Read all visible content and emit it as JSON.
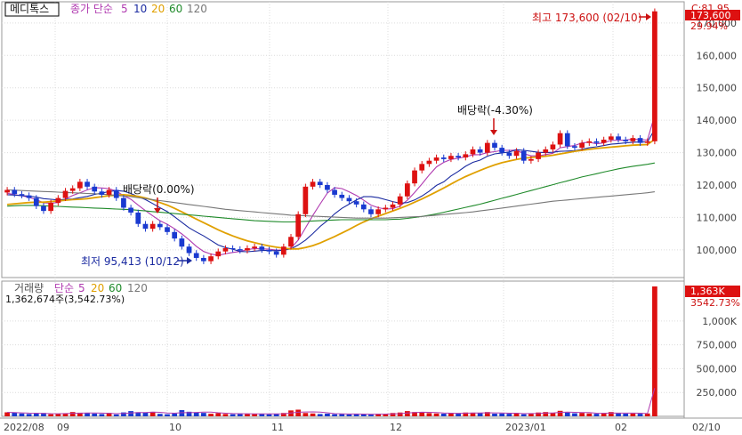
{
  "price_legend": {
    "stock_name": "메디톡스",
    "label": "종가 단순",
    "periods": [
      "5",
      "10",
      "20",
      "60",
      "120"
    ],
    "colors": [
      "#b03ab0",
      "#1a2aa0",
      "#e0a000",
      "#1f8a2a",
      "#777777"
    ]
  },
  "price_right_labels": {
    "top": "C:81.95",
    "current": "173,600",
    "change": "29.94%"
  },
  "volume_legend": {
    "label": "거래량",
    "ma_label": "단순",
    "periods": [
      "5",
      "20",
      "60",
      "120"
    ],
    "colors": [
      "#b03ab0",
      "#e0a000",
      "#1f8a2a",
      "#777777"
    ],
    "value_line": "1,362,674주(3,542.73%)"
  },
  "volume_right_labels": {
    "current": "1,363K",
    "change": "3542.73%"
  },
  "annotations": {
    "high": "최고 173,600 (02/10)",
    "low": "최저 95,413 (10/12)",
    "dividend1": "배당락(0.00%)",
    "dividend2": "배당락(-4.30%)"
  },
  "chart_data": [
    {
      "type": "candlestick",
      "title": "메디톡스",
      "x_labels": [
        "2022/08",
        "09",
        "10",
        "11",
        "12",
        "2023/01",
        "02",
        "02/10"
      ],
      "y_ticks": [
        "100,000",
        "110,000",
        "120,000",
        "130,000",
        "140,000",
        "150,000",
        "160,000",
        "170,000"
      ],
      "ylim": [
        92000,
        176000
      ],
      "series": [
        {
          "name": "종가",
          "values": [
            118500,
            117200,
            116800,
            116000,
            113500,
            112000,
            114500,
            116000,
            118200,
            119000,
            121000,
            119500,
            118000,
            117000,
            118500,
            116000,
            113000,
            111500,
            108000,
            106500,
            108000,
            107000,
            105500,
            103500,
            101000,
            99000,
            97500,
            96500,
            98000,
            99500,
            100500,
            100200,
            99800,
            100500,
            101000,
            100000,
            99500,
            98500,
            101000,
            104000,
            111000,
            119500,
            121000,
            120000,
            118500,
            117000,
            116000,
            115000,
            114000,
            112500,
            111000,
            112500,
            113000,
            114000,
            116500,
            120500,
            124500,
            126500,
            127500,
            128500,
            128000,
            129000,
            128500,
            129500,
            131000,
            130000,
            133000,
            131500,
            130000,
            129000,
            130500,
            127500,
            128000,
            130000,
            131000,
            132500,
            136000,
            132000,
            131500,
            133000,
            133500,
            133000,
            134000,
            135000,
            134000,
            133500,
            134500,
            133000,
            133500,
            173600
          ]
        },
        {
          "name": "5",
          "values": [
            117500,
            117000,
            116700,
            116200,
            115500,
            114500,
            114400,
            114600,
            115700,
            116800,
            117600,
            118500,
            119200,
            119100,
            118900,
            118100,
            116700,
            115600,
            113800,
            112100,
            110500,
            109000,
            107900,
            106500,
            104900,
            103100,
            101100,
            99500,
            98700,
            98300,
            98800,
            99200,
            99500,
            100100,
            100400,
            100300,
            100200,
            99900,
            100000,
            100600,
            103000,
            106800,
            110600,
            114100,
            117500,
            119200,
            118900,
            117900,
            116800,
            115300,
            113800,
            113000,
            112600,
            112700,
            113500,
            115300,
            117700,
            120300,
            123100,
            125600,
            127000,
            127900,
            128300,
            128700,
            129300,
            129400,
            130000,
            130300,
            130700,
            130700,
            130800,
            129700,
            129000,
            129000,
            129400,
            129800,
            131500,
            131900,
            132200,
            133000,
            133200,
            132700,
            133000,
            133800,
            133800,
            133900,
            134200,
            134000,
            133900,
            141600
          ]
        },
        {
          "name": "10",
          "values": [
            117000,
            116900,
            116700,
            116600,
            116300,
            115800,
            115600,
            115400,
            115600,
            115700,
            116100,
            116500,
            117100,
            117500,
            118000,
            118300,
            118100,
            117400,
            116400,
            115500,
            114300,
            113000,
            111800,
            110200,
            108500,
            106800,
            105500,
            104300,
            102900,
            101500,
            100700,
            100200,
            99500,
            99400,
            99600,
            99800,
            99800,
            99700,
            99900,
            100300,
            101500,
            103000,
            105000,
            107200,
            109000,
            111100,
            112800,
            114100,
            115400,
            116400,
            116400,
            116100,
            115500,
            114900,
            114400,
            114600,
            115400,
            116600,
            118100,
            119900,
            121000,
            122800,
            124200,
            125800,
            127000,
            127700,
            128900,
            129600,
            129900,
            130200,
            130900,
            130700,
            130400,
            130100,
            130000,
            130100,
            130400,
            130500,
            130600,
            131000,
            131500,
            131800,
            132200,
            132600,
            132800,
            133000,
            133200,
            133300,
            133300,
            137200
          ]
        },
        {
          "name": "20",
          "values": [
            114000,
            114200,
            114400,
            114600,
            114700,
            114700,
            114900,
            115100,
            115300,
            115500,
            115600,
            115800,
            116100,
            116400,
            116700,
            116900,
            117000,
            116800,
            116500,
            116000,
            115400,
            114600,
            113800,
            112800,
            111700,
            110600,
            109500,
            108400,
            107300,
            106200,
            105200,
            104300,
            103500,
            102800,
            102200,
            101700,
            101200,
            100800,
            100500,
            100300,
            100300,
            100700,
            101300,
            102100,
            103100,
            104100,
            105200,
            106300,
            107500,
            108600,
            109600,
            110400,
            111200,
            112000,
            112800,
            113700,
            114700,
            115700,
            116800,
            117900,
            119100,
            120300,
            121500,
            122600,
            123600,
            124500,
            125400,
            126200,
            126900,
            127400,
            127900,
            128300,
            128500,
            128700,
            128900,
            129200,
            129600,
            130000,
            130400,
            130700,
            131000,
            131300,
            131500,
            131700,
            131900,
            132100,
            132300,
            132400,
            132500,
            134100
          ]
        },
        {
          "name": "60",
          "values": [
            113500,
            113600,
            113700,
            113700,
            113700,
            113600,
            113500,
            113400,
            113300,
            113200,
            113100,
            113000,
            112900,
            112800,
            112700,
            112600,
            112500,
            112400,
            112200,
            112000,
            111800,
            111600,
            111400,
            111200,
            111000,
            110800,
            110600,
            110400,
            110200,
            110000,
            109800,
            109600,
            109400,
            109200,
            109000,
            108900,
            108800,
            108700,
            108600,
            108600,
            108700,
            108800,
            108900,
            109000,
            109100,
            109200,
            109300,
            109300,
            109300,
            109300,
            109300,
            109300,
            109300,
            109400,
            109500,
            109700,
            110000,
            110300,
            110700,
            111100,
            111600,
            112100,
            112600,
            113100,
            113600,
            114100,
            114700,
            115300,
            115900,
            116500,
            117100,
            117700,
            118300,
            118900,
            119500,
            120100,
            120700,
            121300,
            121900,
            122500,
            123000,
            123500,
            124000,
            124500,
            125000,
            125400,
            125800,
            126100,
            126400,
            126800
          ]
        },
        {
          "name": "120",
          "values": [
            118500,
            118400,
            118300,
            118200,
            118100,
            118000,
            117900,
            117800,
            117700,
            117600,
            117500,
            117400,
            117300,
            117200,
            117000,
            116800,
            116600,
            116400,
            116100,
            115800,
            115500,
            115200,
            114900,
            114600,
            114300,
            114000,
            113700,
            113400,
            113100,
            112800,
            112500,
            112300,
            112100,
            111900,
            111700,
            111500,
            111300,
            111100,
            110900,
            110700,
            110600,
            110500,
            110400,
            110300,
            110200,
            110100,
            110000,
            109900,
            109800,
            109800,
            109800,
            109800,
            109800,
            109900,
            110000,
            110100,
            110200,
            110300,
            110500,
            110700,
            110900,
            111100,
            111300,
            111500,
            111700,
            112000,
            112300,
            112600,
            112900,
            113200,
            113500,
            113800,
            114100,
            114400,
            114700,
            115000,
            115200,
            115400,
            115600,
            115800,
            116000,
            116200,
            116400,
            116600,
            116800,
            117000,
            117200,
            117400,
            117600,
            117900
          ]
        }
      ],
      "highest": {
        "value": 173600,
        "date": "02/10"
      },
      "lowest": {
        "value": 95413,
        "date": "10/12"
      }
    },
    {
      "type": "bar",
      "title": "거래량",
      "y_ticks": [
        "250,000",
        "500,000",
        "750,000",
        "1,000K"
      ],
      "ylim": [
        0,
        1400000
      ],
      "values": [
        42000,
        38000,
        30000,
        25000,
        28000,
        35000,
        22000,
        27000,
        31000,
        45000,
        38000,
        33000,
        29000,
        24000,
        36000,
        20000,
        41000,
        55000,
        43000,
        38000,
        47000,
        26000,
        22000,
        30000,
        65000,
        48000,
        42000,
        36000,
        27000,
        33000,
        25000,
        22000,
        30000,
        26000,
        24000,
        28000,
        21000,
        25000,
        35000,
        62000,
        70000,
        35000,
        30000,
        24000,
        28000,
        22000,
        25000,
        20000,
        26000,
        23000,
        18000,
        27000,
        22000,
        35000,
        40000,
        55000,
        45000,
        38000,
        34000,
        30000,
        28000,
        35000,
        30000,
        40000,
        38000,
        33000,
        45000,
        28000,
        30000,
        27000,
        35000,
        22000,
        30000,
        40000,
        45000,
        36000,
        58000,
        40000,
        32000,
        36000,
        30000,
        27000,
        35000,
        45000,
        32000,
        28000,
        30000,
        27000,
        30000,
        1362674
      ]
    }
  ]
}
